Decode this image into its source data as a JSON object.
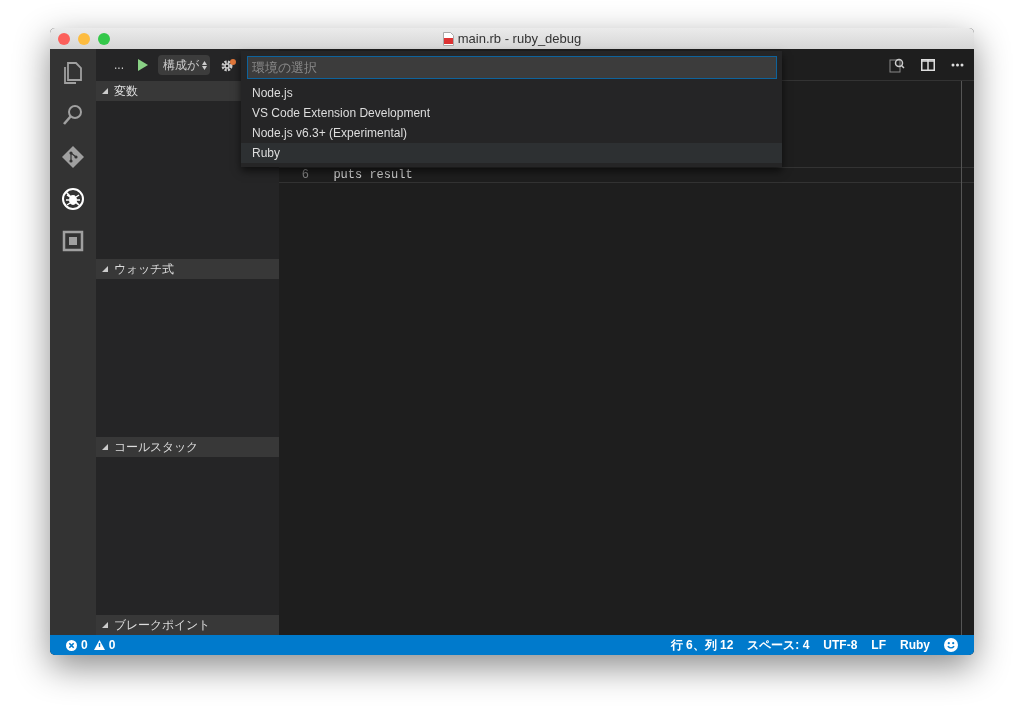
{
  "window": {
    "title": "main.rb - ruby_debug"
  },
  "activity_bar": [
    {
      "kind": "explorer",
      "selected": false
    },
    {
      "kind": "search",
      "selected": false
    },
    {
      "kind": "git",
      "selected": false
    },
    {
      "kind": "debug",
      "selected": true
    },
    {
      "kind": "extensions",
      "selected": false
    }
  ],
  "debug_toolbar": {
    "more": "...",
    "configuration": "構成が"
  },
  "sidebar": {
    "sections": [
      {
        "title": "変数",
        "expanded": true
      },
      {
        "title": "ウォッチ式",
        "expanded": true
      },
      {
        "title": "コールスタック",
        "expanded": true
      },
      {
        "title": "ブレークポイント",
        "expanded": true
      }
    ]
  },
  "quick_pick": {
    "placeholder": "環境の選択",
    "items": [
      {
        "label": "Node.js",
        "selected": false
      },
      {
        "label": "VS Code Extension Development",
        "selected": false
      },
      {
        "label": "Node.js v6.3+ (Experimental)",
        "selected": false
      },
      {
        "label": "Ruby",
        "selected": true
      }
    ]
  },
  "editor": {
    "lines": [
      {
        "number": "6",
        "code": "  puts result"
      }
    ]
  },
  "status_bar": {
    "errors": "0",
    "warnings": "0",
    "items": [
      "行 6、列 12",
      "スペース: 4",
      "UTF-8",
      "LF",
      "Ruby"
    ]
  }
}
